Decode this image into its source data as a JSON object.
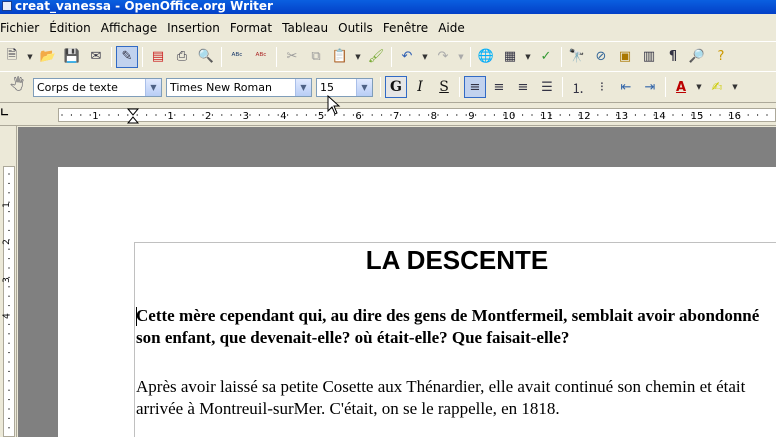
{
  "window": {
    "title": "creat_vanessa - OpenOffice.org Writer"
  },
  "menu": [
    "Fichier",
    "Édition",
    "Affichage",
    "Insertion",
    "Format",
    "Tableau",
    "Outils",
    "Fenêtre",
    "Aide"
  ],
  "format_toolbar": {
    "paragraph_style": "Corps de texte",
    "font_name": "Times New Roman",
    "font_size": "15",
    "bold_label": "G",
    "italic_label": "I",
    "shadow_label": "S"
  },
  "ruler": {
    "numbers": [
      "1",
      "1",
      "2",
      "3",
      "4",
      "5",
      "6",
      "7",
      "8",
      "9",
      "10",
      "11",
      "12",
      "13",
      "14",
      "15",
      "16"
    ],
    "vertical_numbers": [
      "1",
      "1",
      "2",
      "3",
      "4"
    ]
  },
  "document": {
    "title": "LA DESCENTE",
    "paragraph1": "Cette mère cependant qui, au dire des gens de Montfermeil, semblait avoir abondonné son enfant, que devenait-elle? où était-elle? Que faisait-elle?",
    "paragraph2": "Après avoir laissé sa petite Cosette aux Thénardier, elle avait continué son chemin et était arrivée à Montreuil-surMer. C'était, on se le rappelle, en 1818."
  },
  "colors": {
    "titlebar": "#0a5fe0",
    "workspace": "#808080",
    "chrome": "#ece9d8"
  },
  "icons": {
    "standard": [
      "new-doc-icon",
      "open-folder-icon",
      "save-icon",
      "email-icon",
      "edit-mode-icon",
      "export-pdf-icon",
      "print-icon",
      "print-preview-icon",
      "spellcheck-icon",
      "autospell-icon",
      "cut-icon",
      "copy-icon",
      "paste-icon",
      "clone-format-icon",
      "undo-icon",
      "redo-icon",
      "hyperlink-icon",
      "table-icon",
      "draw-functions-icon",
      "find-replace-icon",
      "navigator-icon",
      "gallery-icon",
      "data-sources-icon",
      "nonprinting-chars-icon",
      "zoom-icon",
      "help-icon"
    ]
  }
}
